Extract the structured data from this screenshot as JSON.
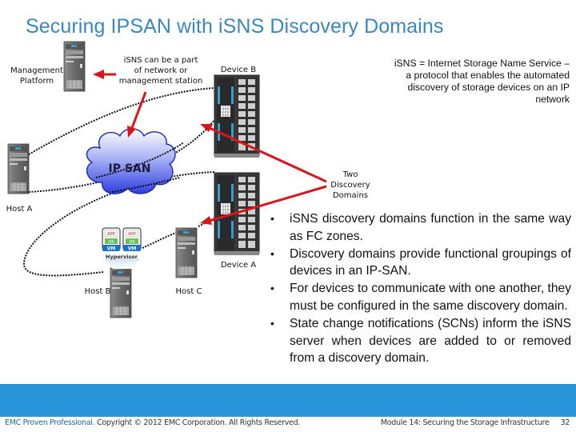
{
  "slide": {
    "title": "Securing IPSAN with iSNS Discovery Domains",
    "accent_color": "#3a87bf",
    "band_color": "#2b95da"
  },
  "diagram": {
    "management_platform_label_line1": "Management",
    "management_platform_label_line2": "Platform",
    "isns_callout_line1": "iSNS can be a part",
    "isns_callout_line2": "of network or",
    "isns_callout_line3": "management station",
    "device_b_label": "Device B",
    "device_a_label": "Device A",
    "cloud_label": "IP SAN",
    "host_a_label": "Host A",
    "host_b_label": "Host B",
    "host_c_label": "Host C",
    "hypervisor_label": "Hypervisor",
    "vm_label": "VM",
    "app_label": "APP",
    "os_label": "OS",
    "discovery_callout_line1": "Two",
    "discovery_callout_line2": "Discovery",
    "discovery_callout_line3": "Domains",
    "arrow_color": "#d9141b"
  },
  "note": {
    "text": "iSNS = Internet Storage Name Service – a protocol that enables the automated discovery of storage devices on an IP network"
  },
  "bullets": [
    "iSNS discovery domains function in the same way as FC zones.",
    "Discovery domains provide functional groupings of devices in an IP-SAN.",
    "For devices to communicate with one another, they must be configured in the same discovery domain.",
    "State change notifications (SCNs) inform the iSNS server when devices are added to or removed from a discovery domain."
  ],
  "footer": {
    "brand": "EMC Proven Professional.",
    "copyright": " Copyright © 2012 EMC Corporation. All Rights Reserved.",
    "module": "Module 14: Securing the Storage Infrastructure",
    "page": "32"
  }
}
